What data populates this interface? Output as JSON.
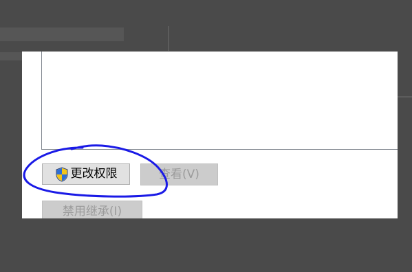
{
  "dialog": {
    "buttons": {
      "change_permissions_label": "更改权限",
      "view_label": "查看(V)",
      "disable_inheritance_label": "禁用继承(I)"
    },
    "icons": {
      "uac_shield": "uac-shield-icon"
    }
  },
  "annotation": {
    "shape": "hand-drawn circle around change-permissions button",
    "color": "#1a1ae6"
  },
  "colors": {
    "backdrop": "#4a4a4a",
    "panel": "#ffffff",
    "button_face": "#e1e1e1",
    "button_disabled": "#cccccc",
    "annotation": "#1a1ae6"
  }
}
